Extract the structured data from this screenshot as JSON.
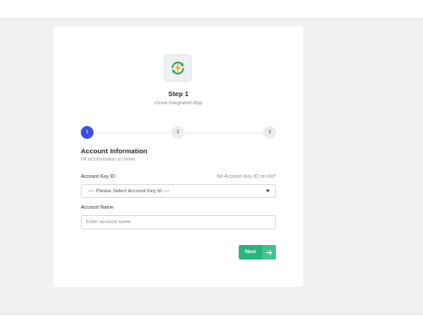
{
  "wizard": {
    "step_title": "Step 1",
    "step_subtitle": "vSure Integration App",
    "steps": [
      "1",
      "2",
      "3"
    ],
    "active_step": 1
  },
  "section": {
    "title": "Account Information",
    "subtitle": "Fill all information as below"
  },
  "fields": {
    "account_key": {
      "label": "Account Key ID",
      "hint": "No Account Key ID on list?",
      "selected": "---- Please Select Account Key Id ----"
    },
    "account_name": {
      "label": "Account Name",
      "placeholder": "Enter account name",
      "value": ""
    }
  },
  "actions": {
    "next_label": "Next"
  },
  "colors": {
    "accent": "#3b4fe0",
    "success": "#27b57e",
    "app_icon_green": "#2fa84f",
    "app_icon_orange": "#f5a623"
  },
  "icons": {
    "app": "lightning-sync-icon",
    "next": "arrow-right-icon",
    "select": "chevron-down-icon"
  }
}
